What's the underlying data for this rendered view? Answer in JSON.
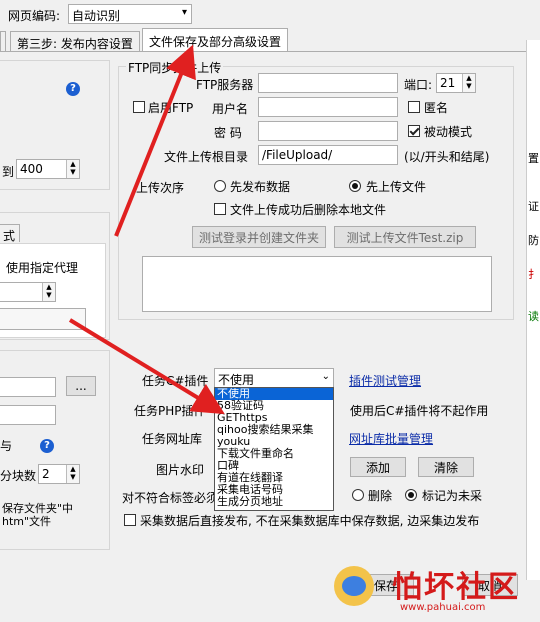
{
  "top": {
    "encoding_label": "网页编码:",
    "encoding_value": "自动识别"
  },
  "tabs": [
    {
      "label": "第三步: 发布内容设置"
    },
    {
      "label": "文件保存及部分高级设置"
    }
  ],
  "ftp": {
    "group_title": "FTP同步文件上传",
    "enable_label": "启用FTP",
    "server_label": "FTP服务器",
    "port_label": "端口:",
    "port_value": "21",
    "user_label": "用户名",
    "anon_label": "匿名",
    "pwd_label": "密  码",
    "passive_label": "被动模式",
    "root_label": "文件上传根目录",
    "root_value": "/FileUpload/",
    "root_hint": "(以/开头和结尾)",
    "order_label": "上传次序",
    "order_opt1": "先发布数据",
    "order_opt2": "先上传文件",
    "delete_local_label": "文件上传成功后删除本地文件",
    "test_login_btn": "测试登录并创建文件夹",
    "test_upload_btn": "测试上传文件Test.zip"
  },
  "plugins": {
    "csharp_label": "任务C#插件",
    "csharp_value": "不使用",
    "csharp_options": [
      "不使用",
      "58验证码",
      "GEThttps",
      "qihoo搜索结果采集",
      "youku",
      "下载文件重命名",
      "口碑",
      "有道在线翻译",
      "采集电话号码",
      "生成分页地址"
    ],
    "test_link": "插件测试管理",
    "php_label": "任务PHP插件",
    "php_note": "使用后C#插件将不起作用",
    "url_label": "任务网址库",
    "url_link": "网址库批量管理",
    "watermark_label": "图片水印",
    "add_btn": "添加",
    "clear_btn": "清除",
    "mismatch_label": "对不符合标签必须要求的数据",
    "delete_label": "删除",
    "mark_label": "标记为未采",
    "direct_publish_label": "采集数据后直接发布, 不在采集数据库中保存数据, 边采集边发布",
    "save_btn": "保存",
    "cancel_btn": "取消"
  },
  "left": {
    "limit_prefix": "到",
    "limit_value": "400",
    "tab_fragment": "式",
    "proxy_label": "使用指定代理",
    "browse_btn": "...",
    "tiny_label": "与",
    "block_label": "分块数",
    "block_value": "2",
    "save_folder_text1": "保存文件夹\"中",
    "save_folder_text2": "htm\"文件"
  },
  "right_edge": {
    "chars": [
      "置",
      "证",
      "防",
      "扌",
      "读"
    ]
  },
  "watermark": {
    "brand": "怕坏社区",
    "url": "www.pahuai.com"
  }
}
